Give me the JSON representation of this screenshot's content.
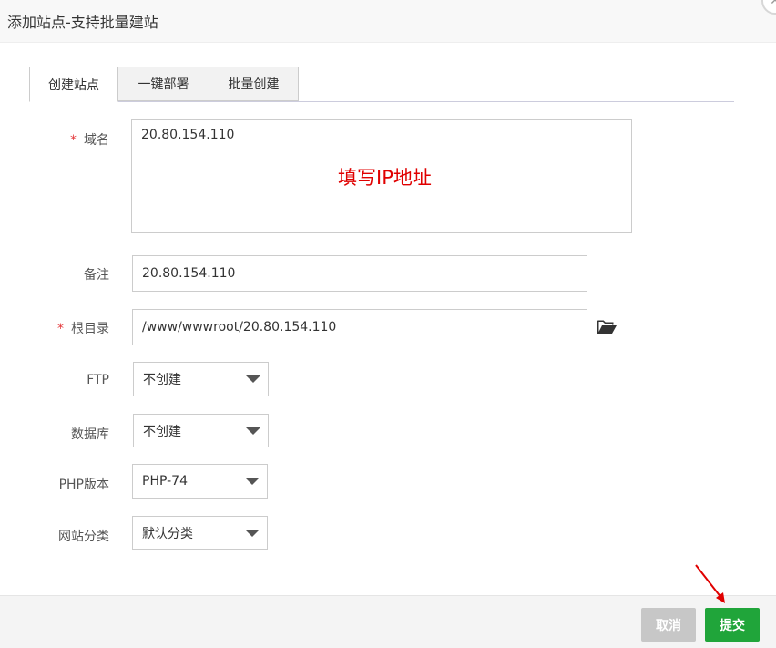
{
  "dialog": {
    "title": "添加站点-支持批量建站"
  },
  "tabs": [
    {
      "label": "创建站点",
      "active": true
    },
    {
      "label": "一键部署",
      "active": false
    },
    {
      "label": "批量创建",
      "active": false
    }
  ],
  "form": {
    "domain": {
      "label": "域名",
      "required": "*",
      "value": "20.80.154.110"
    },
    "domain_note": "填写IP地址",
    "remark": {
      "label": "备注",
      "value": "20.80.154.110"
    },
    "root_dir": {
      "label": "根目录",
      "required": "*",
      "value": "/www/wwwroot/20.80.154.110",
      "icon": "folder-open-icon"
    },
    "ftp": {
      "label": "FTP",
      "value": "不创建"
    },
    "database": {
      "label": "数据库",
      "value": "不创建"
    },
    "php_version": {
      "label": "PHP版本",
      "value": "PHP-74"
    },
    "category": {
      "label": "网站分类",
      "value": "默认分类"
    }
  },
  "footer": {
    "cancel_label": "取消",
    "submit_label": "提交"
  },
  "colors": {
    "required": "#e4393c",
    "note": "#e00000",
    "submit": "#20a53a",
    "cancel": "#c7c7c7",
    "arrow": "#e00000"
  }
}
